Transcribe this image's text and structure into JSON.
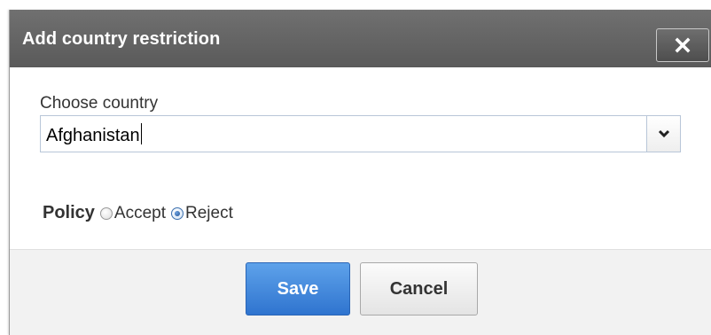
{
  "dialog": {
    "title": "Add country restriction",
    "close_icon": "close-x-icon"
  },
  "form": {
    "country_label": "Choose country",
    "country_value": "Afghanistan",
    "dropdown_icon": "chevron-down-icon",
    "policy_label": "Policy",
    "policy_options": [
      {
        "label": "Accept",
        "selected": false
      },
      {
        "label": "Reject",
        "selected": true
      }
    ]
  },
  "footer": {
    "save_label": "Save",
    "cancel_label": "Cancel"
  },
  "colors": {
    "titlebar": "#5f5f5f",
    "primary_button": "#3b82dc",
    "footer_bg": "#f2f2f2"
  }
}
